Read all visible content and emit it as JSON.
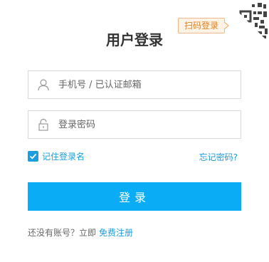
{
  "qr": {
    "tip_label": "扫码登录"
  },
  "page": {
    "title": "用户登录"
  },
  "form": {
    "account": {
      "placeholder": "手机号 / 已认证邮箱",
      "value": ""
    },
    "password": {
      "placeholder": "登录密码",
      "value": ""
    },
    "remember_label": "记住登录名",
    "remember_checked": true,
    "forgot_label": "忘记密码?",
    "submit_label": "登录"
  },
  "footer": {
    "prompt": "还没有账号？立即",
    "register_link": "免费注册"
  },
  "colors": {
    "accent": "#0aacf5",
    "link": "#1a9ee0",
    "tip_bg": "#fff3e6",
    "tip_border": "#f0b88a"
  }
}
